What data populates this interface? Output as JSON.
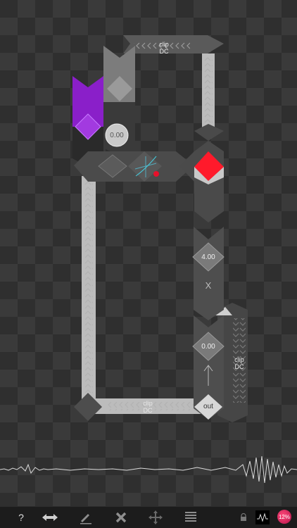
{
  "nodes": {
    "clip_top_label": "clip\nDC",
    "clip_right_label": "clip\nDC",
    "clip_bottom_label": "clip\nDC",
    "knob_value": "0.00",
    "multiply_value": "4.00",
    "multiply_symbol": "X",
    "add_value": "0.00",
    "out_label": "out"
  },
  "toolbar": {
    "help_label": "?",
    "cpu_label": "12%"
  },
  "icons": [
    "resize-icon",
    "pencil-icon",
    "delete-icon",
    "move-icon",
    "list-icon",
    "lock-icon",
    "oscilloscope-icon"
  ],
  "colors": {
    "purple": "#8a1fc9",
    "red": "#ff1a2b",
    "cpu": "#e01f58"
  }
}
